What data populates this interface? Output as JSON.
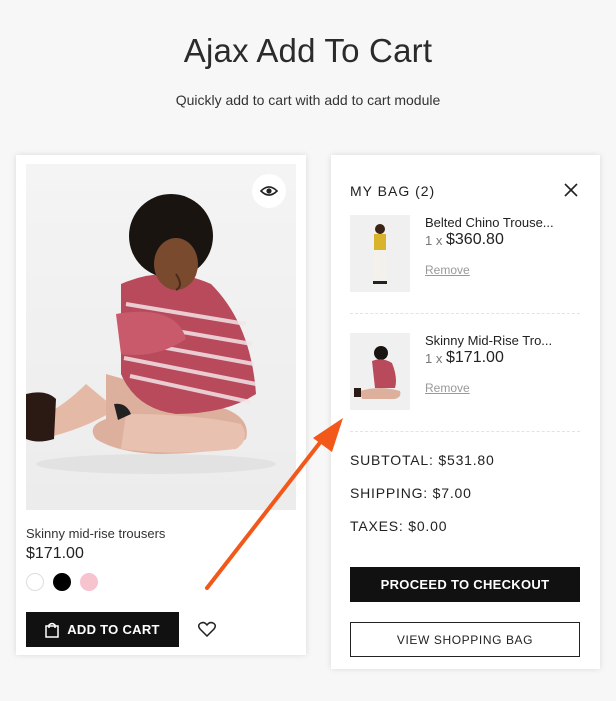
{
  "header": {
    "title": "Ajax Add To Cart",
    "subtitle": "Quickly add to cart with add to cart module"
  },
  "product": {
    "name": "Skinny mid-rise trousers",
    "price": "$171.00",
    "swatches": [
      "#ffffff",
      "#000000",
      "#f6c3cf"
    ],
    "add_to_cart_label": "ADD TO CART",
    "quick_view_icon": "eye-icon",
    "wishlist_icon": "heart-outline-icon"
  },
  "bag": {
    "title": "MY BAG (2)",
    "close_icon": "close-icon",
    "items": [
      {
        "name": "Belted Chino Trouse...",
        "qty": "1 x",
        "price": "$360.80",
        "remove_label": "Remove"
      },
      {
        "name": "Skinny Mid-Rise Tro...",
        "qty": "1 x",
        "price": "$171.00",
        "remove_label": "Remove"
      }
    ],
    "subtotal": "SUBTOTAL: $531.80",
    "shipping": "SHIPPING: $7.00",
    "taxes": "TAXES: $0.00",
    "checkout_label": "PROCEED TO CHECKOUT",
    "view_bag_label": "VIEW SHOPPING BAG"
  },
  "colors": {
    "accent_arrow": "#f2581a",
    "button_dark": "#111111"
  }
}
